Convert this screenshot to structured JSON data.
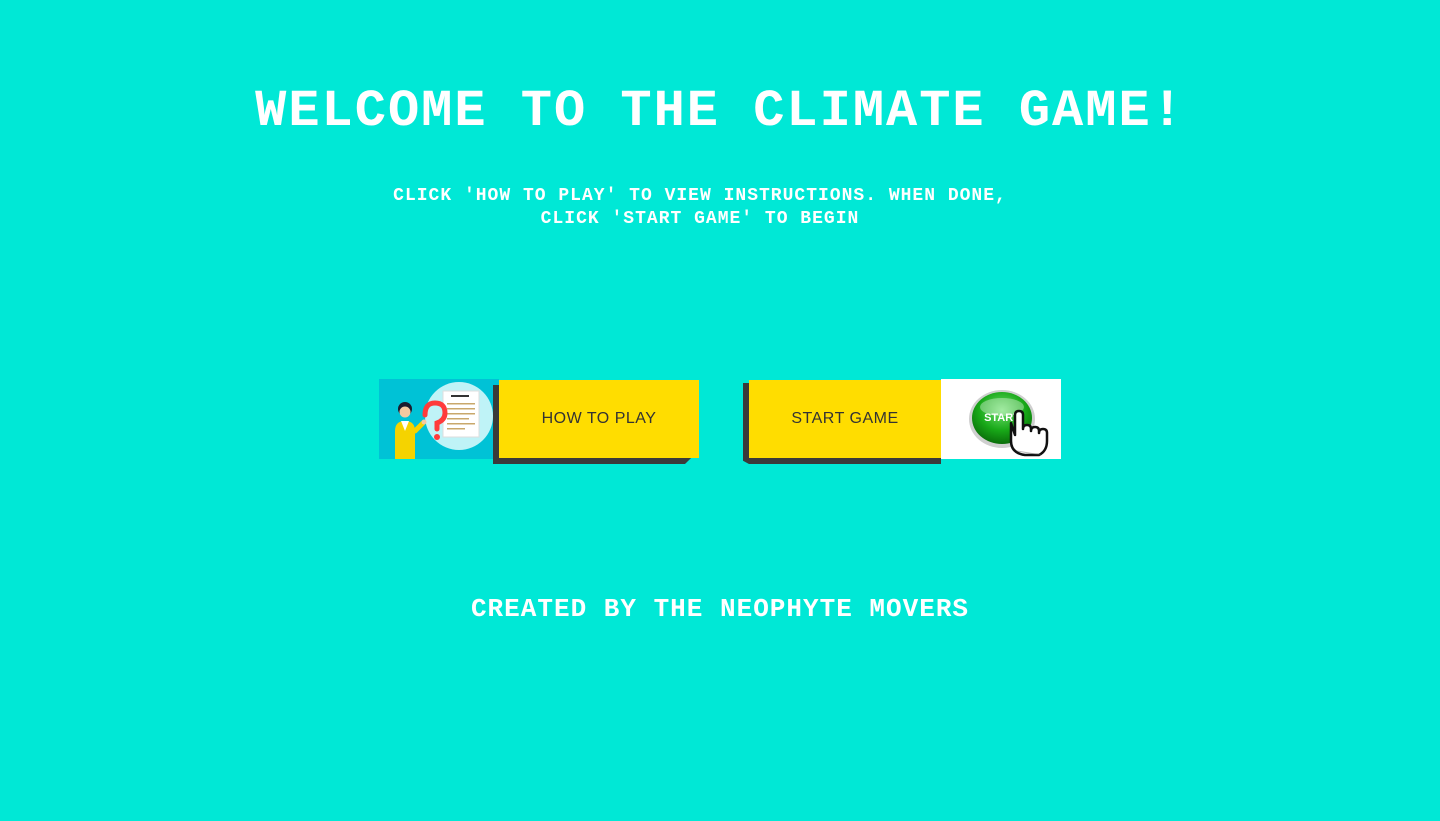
{
  "page": {
    "title": "WELCOME TO THE CLIMATE GAME!",
    "subtitle": "CLICK 'HOW TO PLAY' TO VIEW INSTRUCTIONS. WHEN DONE, CLICK 'START GAME' TO BEGIN",
    "footer": "CREATED BY THE NEOPHYTE MOVERS"
  },
  "buttons": {
    "how_to_play": {
      "label": "HOW TO PLAY",
      "icon": "user-guide-illustration"
    },
    "start_game": {
      "label": "START GAME",
      "icon": "start-button-cursor-illustration",
      "image_text": "START"
    }
  },
  "colors": {
    "background": "#00e8d6",
    "button": "#ffdd00",
    "button_shadow": "#3a3a3a",
    "text": "#ffffff",
    "button_text": "#333333"
  }
}
